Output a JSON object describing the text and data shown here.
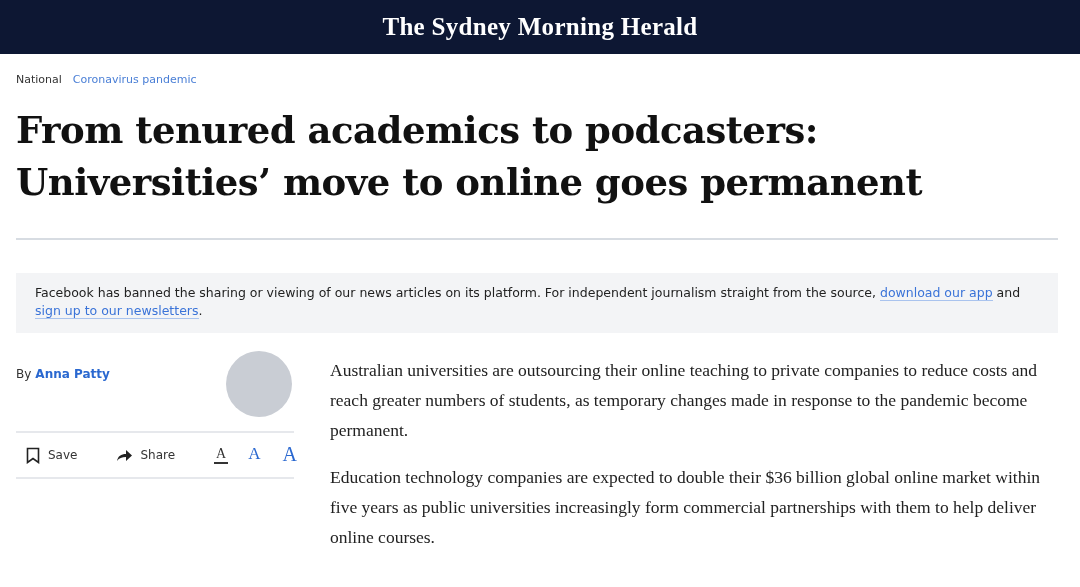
{
  "masthead": {
    "title": "The Sydney Morning Herald"
  },
  "breadcrumbs": [
    "National",
    "Coronavirus pandemic"
  ],
  "headline": "From tenured academics to podcasters: Universities’ move to online goes permanent",
  "notice": {
    "text_before": "Facebook has banned the sharing or viewing of our news articles on its platform. For independent journalism straight from the source,",
    "link_app": "download our app",
    "text_and": "and",
    "link_signup": "sign up to our newsletters",
    "text_end": "."
  },
  "byline": {
    "prefix": "By",
    "author": "Anna Patty"
  },
  "actions": [
    {
      "label": "Save",
      "kind": "save"
    },
    {
      "label": "Share",
      "kind": "share"
    }
  ],
  "font_sizes": [
    {
      "label": "A",
      "selected": true
    },
    {
      "label": "A",
      "selected": false
    },
    {
      "label": "A",
      "selected": false
    }
  ],
  "paragraphs": [
    "Australian universities are outsourcing their online teaching to private companies to reduce costs and reach greater numbers of students, as temporary changes made in response to the pandemic become permanent.",
    "Education technology companies are expected to double their $36 billion global online market within five years as public universities increasingly form commercial partnerships with them to help deliver online courses."
  ]
}
